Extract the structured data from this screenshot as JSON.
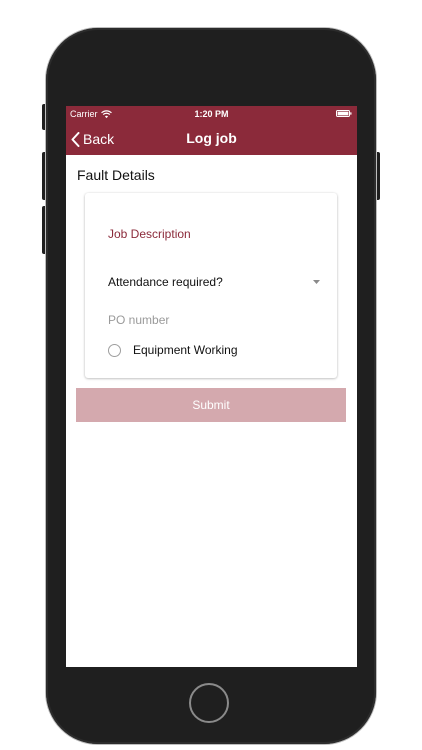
{
  "status_bar": {
    "carrier": "Carrier",
    "time": "1:20 PM"
  },
  "nav": {
    "back_label": "Back",
    "title": "Log job"
  },
  "section": {
    "title": "Fault Details"
  },
  "form": {
    "job_description_label": "Job Description",
    "attendance_label": "Attendance required?",
    "po_number_placeholder": "PO number",
    "equipment_working_label": "Equipment Working",
    "submit_label": "Submit"
  },
  "colors": {
    "brand": "#8b2a3a",
    "submit_disabled": "#d4a9ae",
    "phone_body": "#1f1f1f"
  },
  "icons": {
    "back": "chevron-left-icon",
    "wifi": "wifi-icon",
    "battery": "battery-icon",
    "dropdown": "caret-down-icon",
    "radio": "radio-unchecked-icon"
  }
}
